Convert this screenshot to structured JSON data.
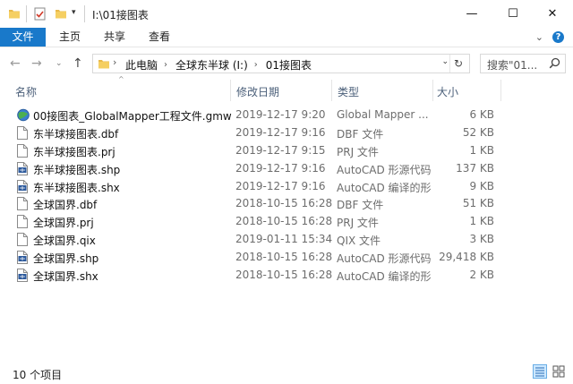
{
  "window": {
    "title": "I:\\01接图表",
    "buttons": {
      "minimize": "—",
      "maximize": "☐",
      "close": "✕"
    }
  },
  "ribbon": {
    "tabs": [
      {
        "label": "文件",
        "active": true
      },
      {
        "label": "主页"
      },
      {
        "label": "共享"
      },
      {
        "label": "查看"
      }
    ],
    "accent": "#1979ca"
  },
  "address": {
    "crumbs": [
      "此电脑",
      "全球东半球 (I:)",
      "01接图表"
    ],
    "search_placeholder": "搜索\"01..."
  },
  "columns": {
    "name": "名称",
    "date": "修改日期",
    "type": "类型",
    "size": "大小"
  },
  "files": [
    {
      "name": "00接图表_GlobalMapper工程文件.gmw",
      "date": "2019-12-17 9:20",
      "type": "Global Mapper ...",
      "size": "6 KB",
      "icon": "globe-icon"
    },
    {
      "name": "东半球接图表.dbf",
      "date": "2019-12-17 9:16",
      "type": "DBF 文件",
      "size": "52 KB",
      "icon": "file-icon"
    },
    {
      "name": "东半球接图表.prj",
      "date": "2019-12-17 9:15",
      "type": "PRJ 文件",
      "size": "1 KB",
      "icon": "file-icon"
    },
    {
      "name": "东半球接图表.shp",
      "date": "2019-12-17 9:16",
      "type": "AutoCAD 形源代码",
      "size": "137 KB",
      "icon": "shx-icon"
    },
    {
      "name": "东半球接图表.shx",
      "date": "2019-12-17 9:16",
      "type": "AutoCAD 编译的形",
      "size": "9 KB",
      "icon": "shx-icon"
    },
    {
      "name": "全球国界.dbf",
      "date": "2018-10-15 16:28",
      "type": "DBF 文件",
      "size": "51 KB",
      "icon": "file-icon"
    },
    {
      "name": "全球国界.prj",
      "date": "2018-10-15 16:28",
      "type": "PRJ 文件",
      "size": "1 KB",
      "icon": "file-icon"
    },
    {
      "name": "全球国界.qix",
      "date": "2019-01-11 15:34",
      "type": "QIX 文件",
      "size": "3 KB",
      "icon": "file-icon"
    },
    {
      "name": "全球国界.shp",
      "date": "2018-10-15 16:28",
      "type": "AutoCAD 形源代码",
      "size": "29,418 KB",
      "icon": "shx-icon"
    },
    {
      "name": "全球国界.shx",
      "date": "2018-10-15 16:28",
      "type": "AutoCAD 编译的形",
      "size": "2 KB",
      "icon": "shx-icon"
    }
  ],
  "status": {
    "count": "10 个项目"
  }
}
